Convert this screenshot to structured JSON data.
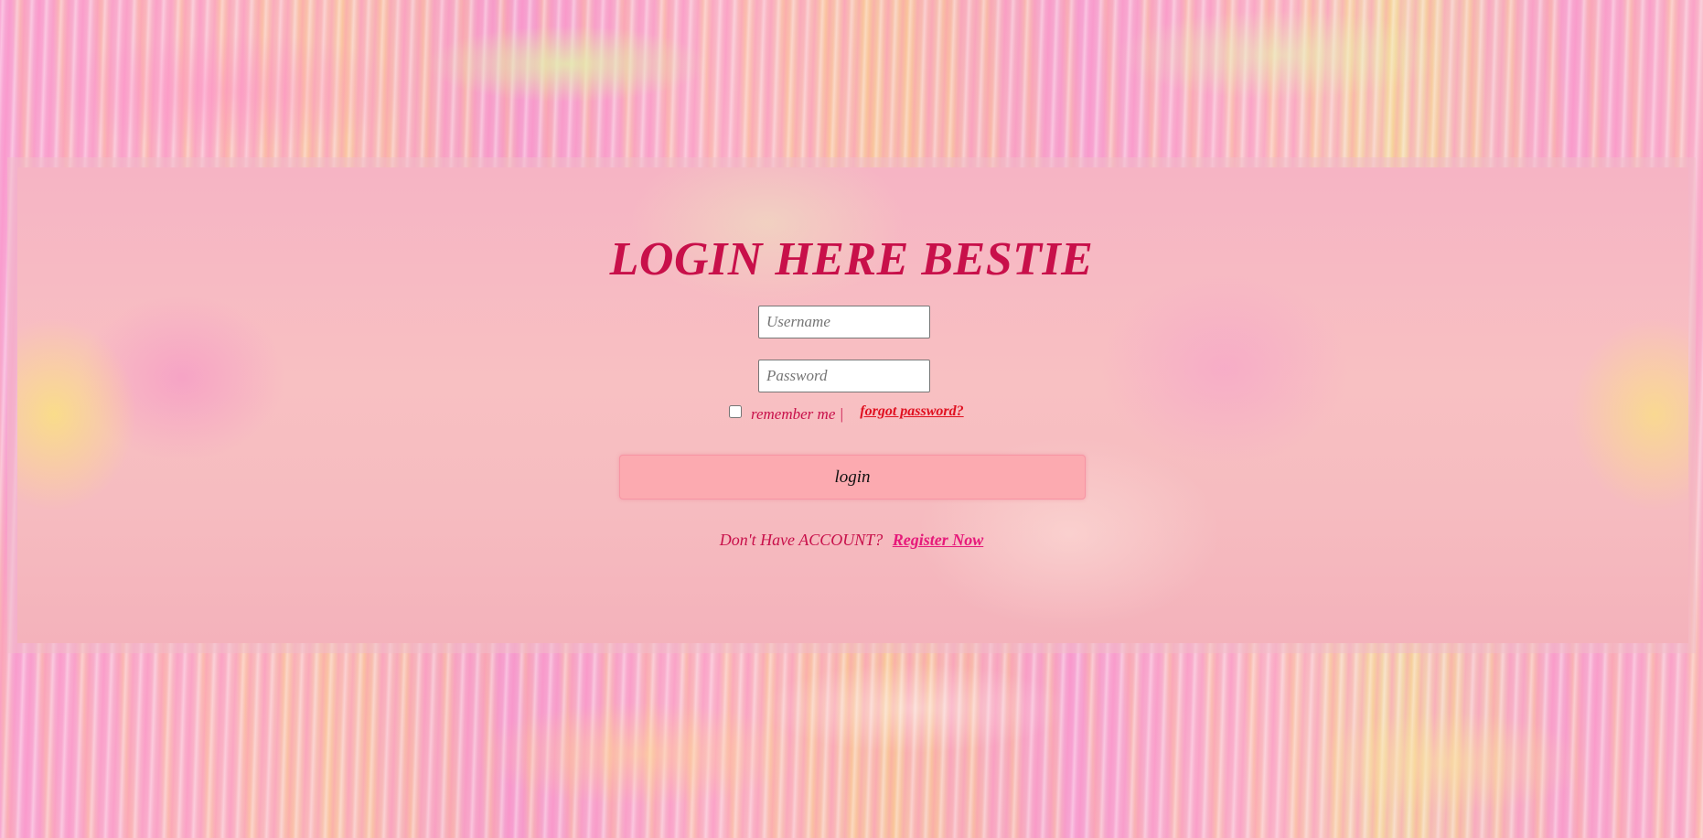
{
  "form": {
    "title": "LOGIN HERE BESTIE",
    "username": {
      "placeholder": "Username",
      "value": ""
    },
    "password": {
      "placeholder": "Password",
      "value": ""
    },
    "remember_label": "remember me |",
    "remember_checked": false,
    "forgot_label": "forgot password?",
    "login_label": "login",
    "register_prompt": "Don't Have ACCOUNT?",
    "register_label": "Register Now"
  },
  "colors": {
    "title": "#c8104a",
    "forgot_link": "#e01020",
    "register_link": "#e6197a",
    "login_button": "#fcaab0"
  }
}
